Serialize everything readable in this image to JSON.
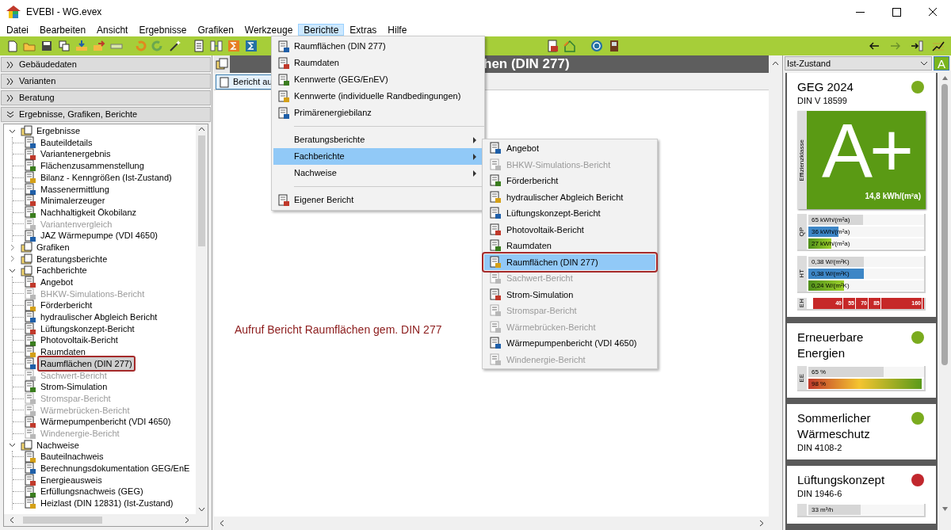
{
  "window": {
    "title": "EVEBI - WG.evex"
  },
  "menu_bar": [
    {
      "label": "Datei",
      "selected": false
    },
    {
      "label": "Bearbeiten",
      "selected": false
    },
    {
      "label": "Ansicht",
      "selected": false
    },
    {
      "label": "Ergebnisse",
      "selected": false
    },
    {
      "label": "Grafiken",
      "selected": false
    },
    {
      "label": "Werkzeuge",
      "selected": false
    },
    {
      "label": "Berichte",
      "selected": true
    },
    {
      "label": "Extras",
      "selected": false
    },
    {
      "label": "Hilfe",
      "selected": false
    }
  ],
  "sidebar": {
    "sections": [
      {
        "label": "Gebäudedaten",
        "expanded": false
      },
      {
        "label": "Varianten",
        "expanded": false
      },
      {
        "label": "Beratung",
        "expanded": false
      },
      {
        "label": "Ergebnisse, Grafiken, Berichte",
        "expanded": true
      }
    ],
    "tree": [
      {
        "label": "Ergebnisse",
        "expanded": true,
        "selected": false,
        "children": [
          {
            "label": "Bauteildetails",
            "disabled": false,
            "selected": false
          },
          {
            "label": "Variantenergebnis",
            "disabled": false,
            "selected": false
          },
          {
            "label": "Flächenzusammenstellung",
            "disabled": false,
            "selected": false
          },
          {
            "label": "Bilanz - Kenngrößen (Ist-Zustand)",
            "disabled": false,
            "selected": false
          },
          {
            "label": "Massenermittlung",
            "disabled": false,
            "selected": false
          },
          {
            "label": "Minimalerzeuger",
            "disabled": false,
            "selected": false
          },
          {
            "label": "Nachhaltigkeit Ökobilanz",
            "disabled": false,
            "selected": false
          },
          {
            "label": "Variantenvergleich",
            "disabled": true,
            "selected": false
          },
          {
            "label": "JAZ Wärmepumpe (VDI 4650)",
            "disabled": false,
            "selected": false
          }
        ]
      },
      {
        "label": "Grafiken",
        "expanded": false,
        "selected": false
      },
      {
        "label": "Beratungsberichte",
        "expanded": false,
        "selected": false
      },
      {
        "label": "Fachberichte",
        "expanded": true,
        "selected": false,
        "children": [
          {
            "label": "Angebot",
            "disabled": false,
            "selected": false
          },
          {
            "label": "BHKW-Simulations-Bericht",
            "disabled": true,
            "selected": false
          },
          {
            "label": "Förderbericht",
            "disabled": false,
            "selected": false
          },
          {
            "label": "hydraulischer Abgleich Bericht",
            "disabled": false,
            "selected": false
          },
          {
            "label": "Lüftungskonzept-Bericht",
            "disabled": false,
            "selected": false
          },
          {
            "label": "Photovoltaik-Bericht",
            "disabled": false,
            "selected": false
          },
          {
            "label": "Raumdaten",
            "disabled": false,
            "selected": false
          },
          {
            "label": "Raumflächen (DIN 277)",
            "disabled": false,
            "selected": true
          },
          {
            "label": "Sachwert-Bericht",
            "disabled": true,
            "selected": false
          },
          {
            "label": "Strom-Simulation",
            "disabled": false,
            "selected": false
          },
          {
            "label": "Stromspar-Bericht",
            "disabled": true,
            "selected": false
          },
          {
            "label": "Wärmebrücken-Bericht",
            "disabled": true,
            "selected": false
          },
          {
            "label": "Wärmepumpenbericht (VDI 4650)",
            "disabled": false,
            "selected": false
          },
          {
            "label": "Windenergie-Bericht",
            "disabled": true,
            "selected": false
          }
        ]
      },
      {
        "label": "Nachweise",
        "expanded": true,
        "selected": false,
        "children": [
          {
            "label": "Bauteilnachweis",
            "disabled": false,
            "selected": false
          },
          {
            "label": "Berechnungsdokumentation GEG/EnE",
            "disabled": false,
            "selected": false
          },
          {
            "label": "Energieausweis",
            "disabled": false,
            "selected": false
          },
          {
            "label": "Erfüllungsnachweis (GEG)",
            "disabled": false,
            "selected": false
          },
          {
            "label": "Heizlast (DIN 12831) (Ist-Zustand)",
            "disabled": false,
            "selected": false
          }
        ]
      }
    ]
  },
  "document": {
    "title": "hen (DIN 277)",
    "tab": "Bericht au",
    "note": "Aufruf Bericht Raumflächen gem. DIN 277"
  },
  "berichte_menu": {
    "groups": [
      [
        {
          "label": "Raumflächen (DIN 277)",
          "submenu": false,
          "selected": false
        },
        {
          "label": "Raumdaten",
          "submenu": false,
          "selected": false
        },
        {
          "label": "Kennwerte (GEG/EnEV)",
          "submenu": false,
          "selected": false
        },
        {
          "label": "Kennwerte (individuelle Randbedingungen)",
          "submenu": false,
          "selected": false
        },
        {
          "label": "Primärenergiebilanz",
          "submenu": false,
          "selected": false
        }
      ],
      [
        {
          "label": "Beratungsberichte",
          "submenu": true,
          "selected": false
        },
        {
          "label": "Fachberichte",
          "submenu": true,
          "selected": true
        },
        {
          "label": "Nachweise",
          "submenu": true,
          "selected": false
        }
      ],
      [
        {
          "label": "Eigener Bericht",
          "submenu": false,
          "selected": false
        }
      ]
    ]
  },
  "fachberichte_submenu": [
    {
      "label": "Angebot",
      "disabled": false,
      "selected": false
    },
    {
      "label": "BHKW-Simulations-Bericht",
      "disabled": true,
      "selected": false
    },
    {
      "label": "Förderbericht",
      "disabled": false,
      "selected": false
    },
    {
      "label": "hydraulischer Abgleich Bericht",
      "disabled": false,
      "selected": false
    },
    {
      "label": "Lüftungskonzept-Bericht",
      "disabled": false,
      "selected": false
    },
    {
      "label": "Photovoltaik-Bericht",
      "disabled": false,
      "selected": false
    },
    {
      "label": "Raumdaten",
      "disabled": false,
      "selected": false
    },
    {
      "label": "Raumflächen (DIN 277)",
      "disabled": false,
      "selected": true
    },
    {
      "label": "Sachwert-Bericht",
      "disabled": true,
      "selected": false
    },
    {
      "label": "Strom-Simulation",
      "disabled": false,
      "selected": false
    },
    {
      "label": "Stromspar-Bericht",
      "disabled": true,
      "selected": false
    },
    {
      "label": "Wärmebrücken-Bericht",
      "disabled": true,
      "selected": false
    },
    {
      "label": "Wärmepumpenbericht (VDI 4650)",
      "disabled": false,
      "selected": false
    },
    {
      "label": "Windenergie-Bericht",
      "disabled": true,
      "selected": false
    }
  ],
  "variant_select": {
    "value": "Ist-Zustand",
    "badge": "A"
  },
  "rating_cards": [
    {
      "title": "GEG 2024",
      "subtitle": "DIN V 18599",
      "color": "#7aab1e",
      "efficiency": {
        "label": "Effizienzklasse",
        "grade": "A+",
        "value": "14,8 kWh/(m²a)"
      },
      "meters": [
        {
          "label": "QP",
          "bars": [
            {
              "kind": "limit",
              "text": "65 kWh/(m²a)",
              "level": 0.47
            },
            {
              "kind": "reference",
              "text": "36 kWh/(m²a)",
              "level": 0.26
            },
            {
              "kind": "actual",
              "text": "27 kWh/(m²a)",
              "level": 0.2
            }
          ]
        },
        {
          "label": "HT",
          "bars": [
            {
              "kind": "limit",
              "text": "0,38 W/(m²K)",
              "level": 0.48
            },
            {
              "kind": "reference",
              "text": "0,38 W/(m²K)",
              "level": 0.48
            },
            {
              "kind": "actual",
              "text": "0,24 W/(m²K)",
              "level": 0.31
            }
          ]
        }
      ],
      "scale": {
        "label": "EH",
        "marks": [
          "40",
          "55",
          "70",
          "85",
          "160"
        ]
      }
    },
    {
      "title": "Erneuerbare Energien",
      "color": "#7aab1e",
      "meters": [
        {
          "label": "EE",
          "bars": [
            {
              "kind": "limit",
              "text": "65 %",
              "level": 0.65
            },
            {
              "kind": "gradient",
              "text": "98 %",
              "level": 0.98
            }
          ]
        }
      ]
    },
    {
      "title": "Sommerlicher Wärmeschutz",
      "subtitle": "DIN 4108-2",
      "color": "#7aab1e"
    },
    {
      "title": "Lüftungskonzept",
      "subtitle": "DIN 1946-6",
      "color": "#c1272d",
      "meters": [
        {
          "bars": [
            {
              "kind": "limit",
              "text": "33 m³/h",
              "level": 0.45
            }
          ]
        }
      ]
    }
  ]
}
